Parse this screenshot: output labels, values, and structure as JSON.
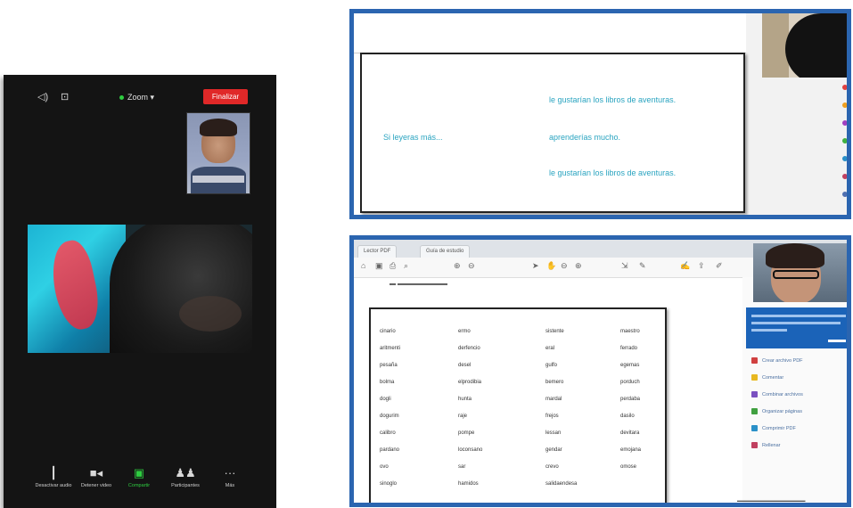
{
  "zoom": {
    "meeting_name": "Zoom",
    "leave_label": "Finalizar",
    "toolbar": [
      {
        "icon": "microphone-icon",
        "glyph": "🎤",
        "label": "Desactivar audio"
      },
      {
        "icon": "video-camera-icon",
        "glyph": "■",
        "label": "Detener video"
      },
      {
        "icon": "share-screen-icon",
        "glyph": "■",
        "label": "Compartir",
        "active": true
      },
      {
        "icon": "participants-icon",
        "glyph": "👥",
        "label": "Participantes"
      },
      {
        "icon": "more-icon",
        "glyph": "•••",
        "label": "Más"
      }
    ]
  },
  "top_frame": {
    "lines": [
      {
        "text": "le gustarían los libros de aventuras."
      },
      {
        "text": "Si leyeras más..."
      },
      {
        "text": "aprenderías mucho."
      },
      {
        "text": "le gustarían los libros de aventuras."
      }
    ]
  },
  "bottom_frame": {
    "tabs": [
      "Lector PDF",
      "Guía de estudio"
    ],
    "table_rows": [
      [
        "cinario",
        "ermo",
        "sistente",
        "maestro"
      ],
      [
        "aritmenti",
        "derfencio",
        "eral",
        "ferrado"
      ],
      [
        "pesaña",
        "desel",
        "gulfo",
        "egemas"
      ],
      [
        "bolma",
        "elprodibia",
        "bemero",
        "porduch"
      ],
      [
        "dogli",
        "hunta",
        "mardal",
        "perdaba"
      ],
      [
        "dogurim",
        "raje",
        "frejos",
        "dasilo"
      ],
      [
        "calibro",
        "pompe",
        "lessan",
        "devitara"
      ],
      [
        "pardano",
        "loconsano",
        "gendar",
        "emojana"
      ],
      [
        "ovo",
        "sar",
        "crevo",
        "omose"
      ],
      [
        "sinoglo",
        "hamidos",
        "salidaendesa",
        ""
      ]
    ],
    "side_menu": [
      {
        "label": "Crear archivo PDF",
        "color": "#d04040"
      },
      {
        "label": "Comentar",
        "color": "#e8b820"
      },
      {
        "label": "Combinar archivos",
        "color": "#7a50c0"
      },
      {
        "label": "Organizar páginas",
        "color": "#40a040"
      },
      {
        "label": "Comprimir PDF",
        "color": "#2a90c8"
      },
      {
        "label": "Rellenar",
        "color": "#c04060"
      }
    ]
  }
}
